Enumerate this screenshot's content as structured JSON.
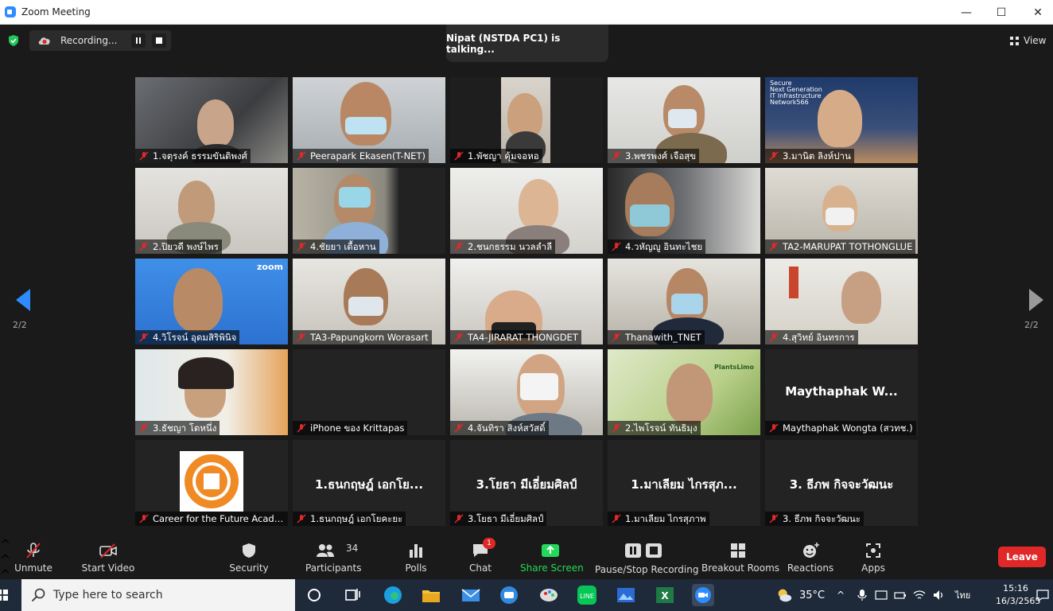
{
  "window": {
    "title": "Zoom Meeting",
    "minimize": "—",
    "maximize": "☐",
    "close": "✕"
  },
  "top": {
    "recording_label": "Recording...",
    "talking": "Nipat (NSTDA PC1) is talking...",
    "view_label": "View"
  },
  "pagination": {
    "left": "2/2",
    "right": "2/2"
  },
  "participants": [
    {
      "name": "1.จตุรงค์ ธรรมขันติพงศ์"
    },
    {
      "name": "Peerapark Ekasen(T-NET)"
    },
    {
      "name": "1.พัชญา คุ้มจอหอ"
    },
    {
      "name": "3.พชรพงศ์ เจือสุข"
    },
    {
      "name": "3.มานิต ลิงห์ปาน"
    },
    {
      "name": "2.ปิยวดี พงษ์ไพร"
    },
    {
      "name": "4.ชัยยา เดื้อหาน"
    },
    {
      "name": "2.ชนกธรรม นวลลำลี"
    },
    {
      "name": "4.วหัญญู อินทะไชย"
    },
    {
      "name": "TA2-MARUPAT TOTHONGLUE"
    },
    {
      "name": "4.วิโรจน์ อุดมสิริพินิจ"
    },
    {
      "name": "TA3-Papungkorn Worasart"
    },
    {
      "name": "TA4-JIRARAT THONGDET"
    },
    {
      "name": "Thanawith_TNET"
    },
    {
      "name": "4.สุวิทย์ อินทรการ"
    },
    {
      "name": "3.ธัชญา โตหนึ่ง"
    },
    {
      "name": "iPhone ของ Krittapas"
    },
    {
      "name": "4.จันทิรา สิงห์สวัสดิ์"
    },
    {
      "name": "2.ไพโรจน์ ทันธิมุง"
    },
    {
      "name": "Maythaphak Wongta (สวทช.)",
      "big": "Maythaphak  W..."
    },
    {
      "name": "Career for the Future Academy"
    },
    {
      "name": "1.ธนกฤษฎ์ เอกโยคะยะ",
      "big": "1.ธนกฤษฎ์ เอกโย..."
    },
    {
      "name": "3.โยธา มีเอี่ยมศิลป์",
      "big": "3.โยธา มีเอี่ยมศิลป์"
    },
    {
      "name": "1.มาเลียม ไกรสุภาพ",
      "big": "1.มาเลียม ไกรสุภ..."
    },
    {
      "name": "3. ธีภพ กิจจะวัฒนะ",
      "big": "3. ธีภพ กิจจะวัฒนะ"
    }
  ],
  "tile_text": {
    "zoom_watermark": "zoom",
    "plant_logo": "PlantsLimo",
    "secure_banner": "Secure\nNext Generation\nIT Infrastructure\nNetwork566"
  },
  "toolbar": {
    "unmute": "Unmute",
    "start_video": "Start Video",
    "security": "Security",
    "participants_count": "34",
    "participants": "Participants",
    "polls": "Polls",
    "chat": "Chat",
    "chat_badge": "1",
    "share_screen": "Share Screen",
    "recording": "Pause/Stop Recording",
    "breakout": "Breakout Rooms",
    "reactions": "Reactions",
    "apps": "Apps",
    "leave": "Leave"
  },
  "taskbar": {
    "search_placeholder": "Type here to search",
    "temperature": "35°C",
    "language": "ไทย",
    "time": "15:16",
    "date": "16/3/2565"
  },
  "colors": {
    "accent": "#2d8cff",
    "leave": "#e02828",
    "share": "#23d959",
    "mic_muted": "#e02828"
  }
}
